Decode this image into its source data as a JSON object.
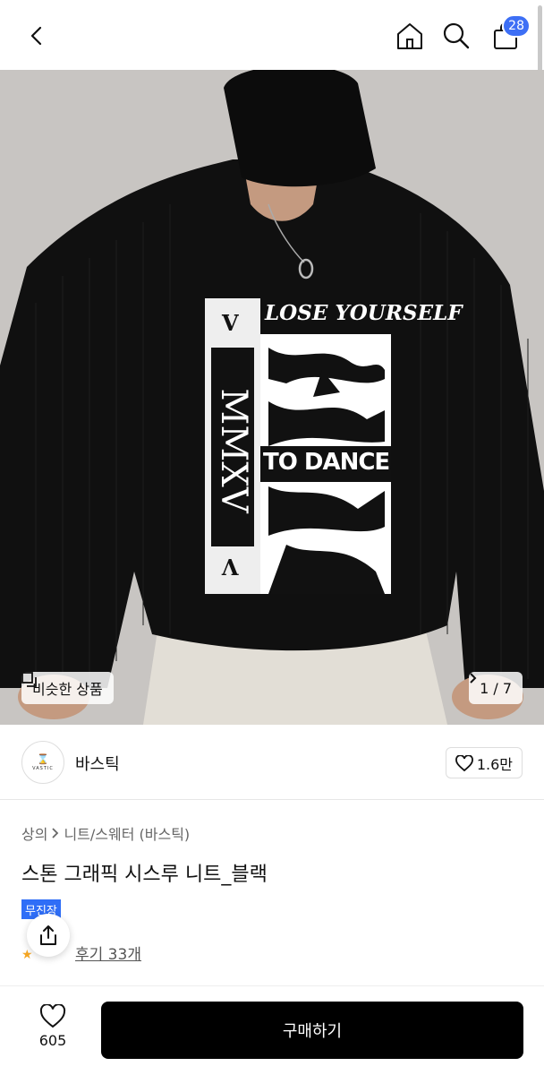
{
  "header": {
    "cart_count": "28"
  },
  "hero": {
    "print_top": "LOSE YOURSELF",
    "print_mid": "TO DANCE",
    "print_side": "MMXV",
    "print_letter_top": "V",
    "print_letter_bottom": "V",
    "similar_label": "비슷한 상품",
    "counter_label": "1 / 7"
  },
  "brand": {
    "logo_text": "VASTIC",
    "name": "바스틱",
    "likes": "1.6만"
  },
  "product": {
    "breadcrumb": [
      "상의",
      "니트/스웨터 (바스틱)"
    ],
    "title": "스톤 그래픽 시스루 니트_블랙",
    "tag": "무진장",
    "reviews": "후기 33개"
  },
  "bottom": {
    "wish_count": "605",
    "buy_label": "구매하기"
  },
  "colors": {
    "accent": "#3d6ff5",
    "tag_bg": "#2f6ef7",
    "buy_bg": "#000000"
  }
}
